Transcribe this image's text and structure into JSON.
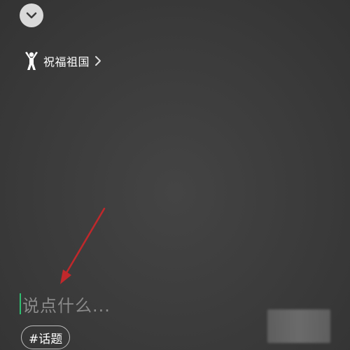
{
  "header": {
    "collapse_icon": "chevron-down-icon"
  },
  "topic": {
    "icon": "person-cheer-icon",
    "label": "祝福祖国",
    "chevron_icon": "chevron-right-icon"
  },
  "caption": {
    "placeholder": "说点什么..."
  },
  "hashtag": {
    "label": "#话题"
  },
  "annotation": {
    "arrow_color": "#c0282b"
  },
  "colors": {
    "background": "#3a3a3a",
    "caret": "#2fbf71",
    "placeholder": "#8a8a8a"
  }
}
